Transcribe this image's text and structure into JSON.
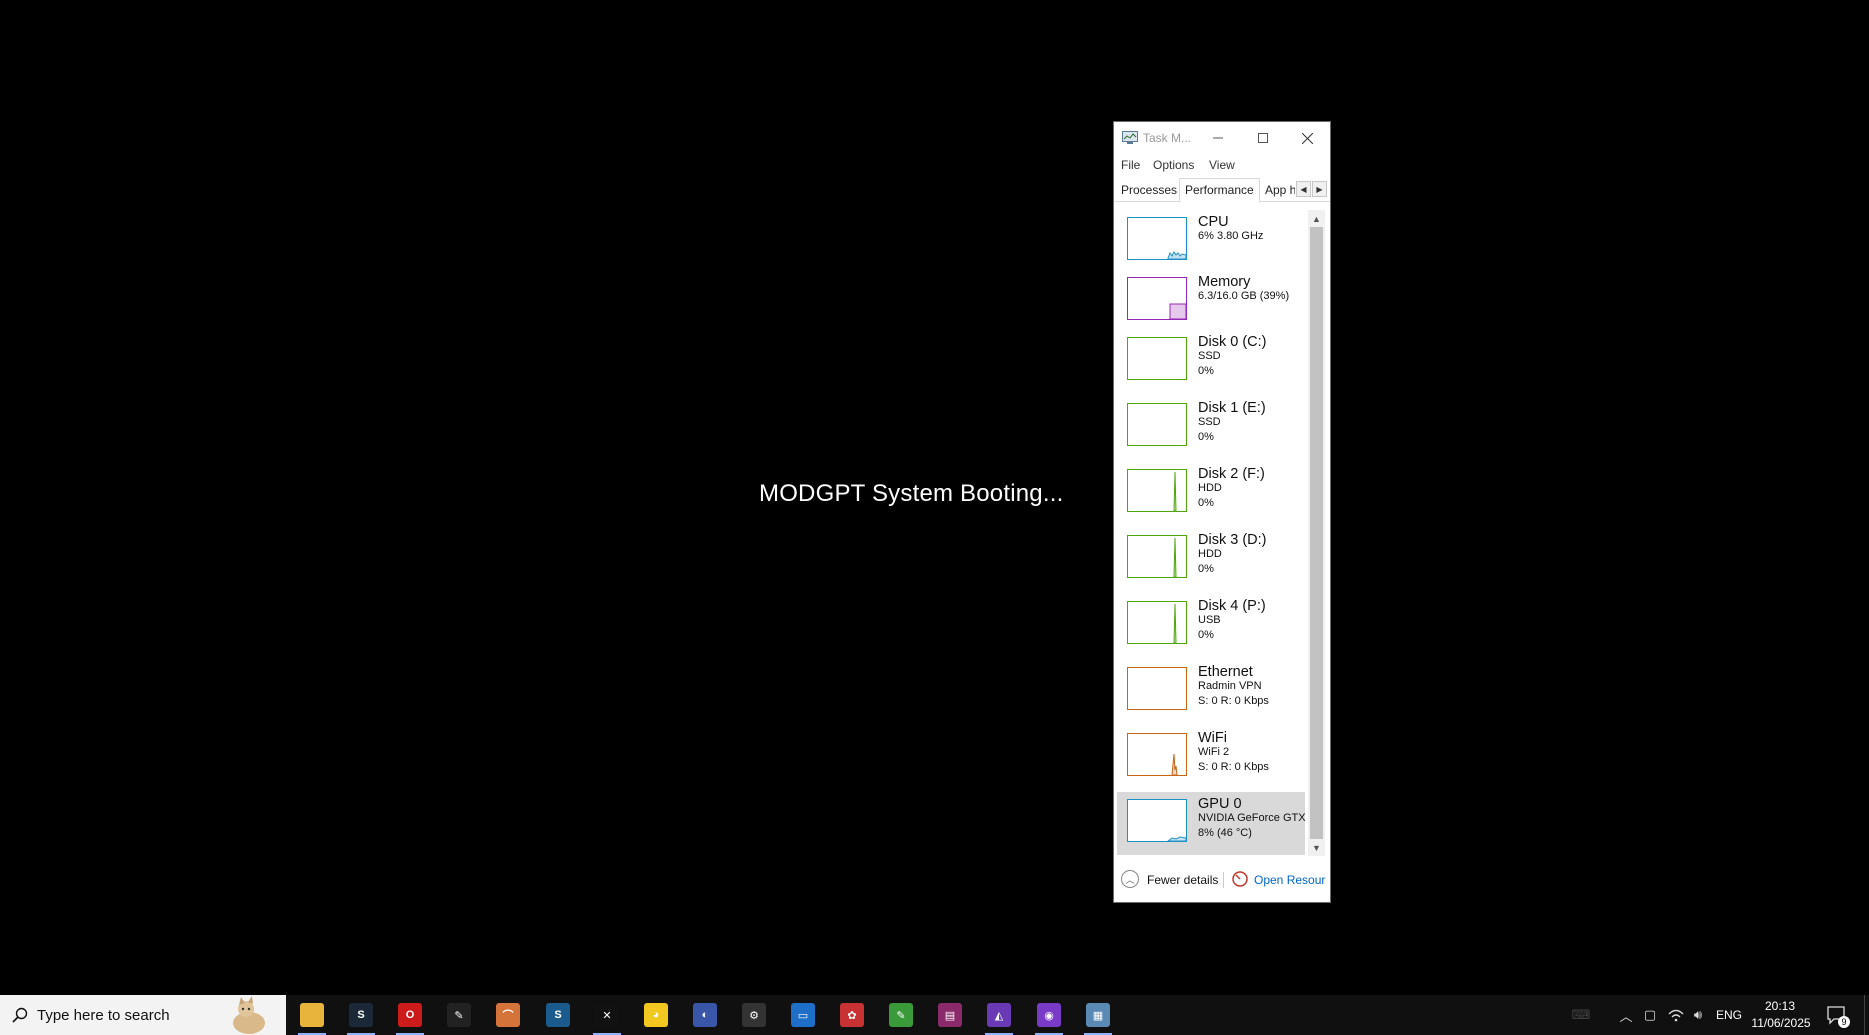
{
  "desktop": {
    "boot_message": "MODGPT System Booting..."
  },
  "task_manager": {
    "title": "Task M...",
    "menu": [
      "File",
      "Options",
      "View"
    ],
    "tabs": [
      {
        "label": "Processes",
        "active": false
      },
      {
        "label": "Performance",
        "active": true
      },
      {
        "label": "App h",
        "active": false
      }
    ],
    "items": [
      {
        "title": "CPU",
        "lines": [
          "6% 3.80 GHz"
        ],
        "color": "#1e90c8",
        "icon": "cpu-graph"
      },
      {
        "title": "Memory",
        "lines": [
          "6.3/16.0 GB (39%)"
        ],
        "color": "#9528b4",
        "icon": "memory-graph"
      },
      {
        "title": "Disk 0 (C:)",
        "lines": [
          "SSD",
          "0%"
        ],
        "color": "#4da60c",
        "icon": "disk-graph"
      },
      {
        "title": "Disk 1 (E:)",
        "lines": [
          "SSD",
          "0%"
        ],
        "color": "#4da60c",
        "icon": "disk-graph"
      },
      {
        "title": "Disk 2 (F:)",
        "lines": [
          "HDD",
          "0%"
        ],
        "color": "#4da60c",
        "icon": "disk-graph"
      },
      {
        "title": "Disk 3 (D:)",
        "lines": [
          "HDD",
          "0%"
        ],
        "color": "#4da60c",
        "icon": "disk-graph"
      },
      {
        "title": "Disk 4 (P:)",
        "lines": [
          "USB",
          "0%"
        ],
        "color": "#4da60c",
        "icon": "disk-graph"
      },
      {
        "title": "Ethernet",
        "lines": [
          "Radmin VPN",
          "S: 0 R: 0 Kbps"
        ],
        "color": "#c86414",
        "icon": "network-graph"
      },
      {
        "title": "WiFi",
        "lines": [
          "WiFi 2",
          "S: 0 R: 0 Kbps"
        ],
        "color": "#c86414",
        "icon": "network-graph"
      },
      {
        "title": "GPU 0",
        "lines": [
          "NVIDIA GeForce GTX",
          "8% (46 °C)"
        ],
        "color": "#1e90c8",
        "icon": "gpu-graph",
        "selected": true
      }
    ],
    "footer": {
      "fewer_details": "Fewer details",
      "open_resource_monitor": "Open Resour"
    }
  },
  "taskbar": {
    "search_placeholder": "Type here to search",
    "apps": [
      {
        "name": "file-explorer",
        "color": "#e8b43c",
        "glyph": ""
      },
      {
        "name": "steam",
        "color": "#1b2838",
        "glyph": "S"
      },
      {
        "name": "opera",
        "color": "#cc1b1b",
        "glyph": "O"
      },
      {
        "name": "app-4",
        "color": "#222222",
        "glyph": "✎"
      },
      {
        "name": "app-5",
        "color": "#d4733a",
        "glyph": "⌒"
      },
      {
        "name": "steam-2",
        "color": "#1b5a8c",
        "glyph": "S"
      },
      {
        "name": "app-7",
        "color": "#111111",
        "glyph": "✕"
      },
      {
        "name": "rubber-duck",
        "color": "#f2c820",
        "glyph": "◕"
      },
      {
        "name": "browser",
        "color": "#3a56a8",
        "glyph": "◐"
      },
      {
        "name": "smm-settings",
        "color": "#333333",
        "glyph": "⚙"
      },
      {
        "name": "window-app",
        "color": "#1e6fc8",
        "glyph": "▭"
      },
      {
        "name": "app-12",
        "color": "#c83232",
        "glyph": "✿"
      },
      {
        "name": "notepad-app",
        "color": "#3a9a3a",
        "glyph": "✎"
      },
      {
        "name": "winrar",
        "color": "#8a2a6a",
        "glyph": "▤"
      },
      {
        "name": "visual-studio",
        "color": "#6a3ab4",
        "glyph": "◭"
      },
      {
        "name": "github-desktop",
        "color": "#7a3ac8",
        "glyph": "◉"
      },
      {
        "name": "task-manager",
        "color": "#5a8ab4",
        "glyph": "▦"
      }
    ],
    "tray": {
      "language": "ENG",
      "time": "20:13",
      "date": "11/06/2025",
      "notification_count": "9"
    }
  }
}
